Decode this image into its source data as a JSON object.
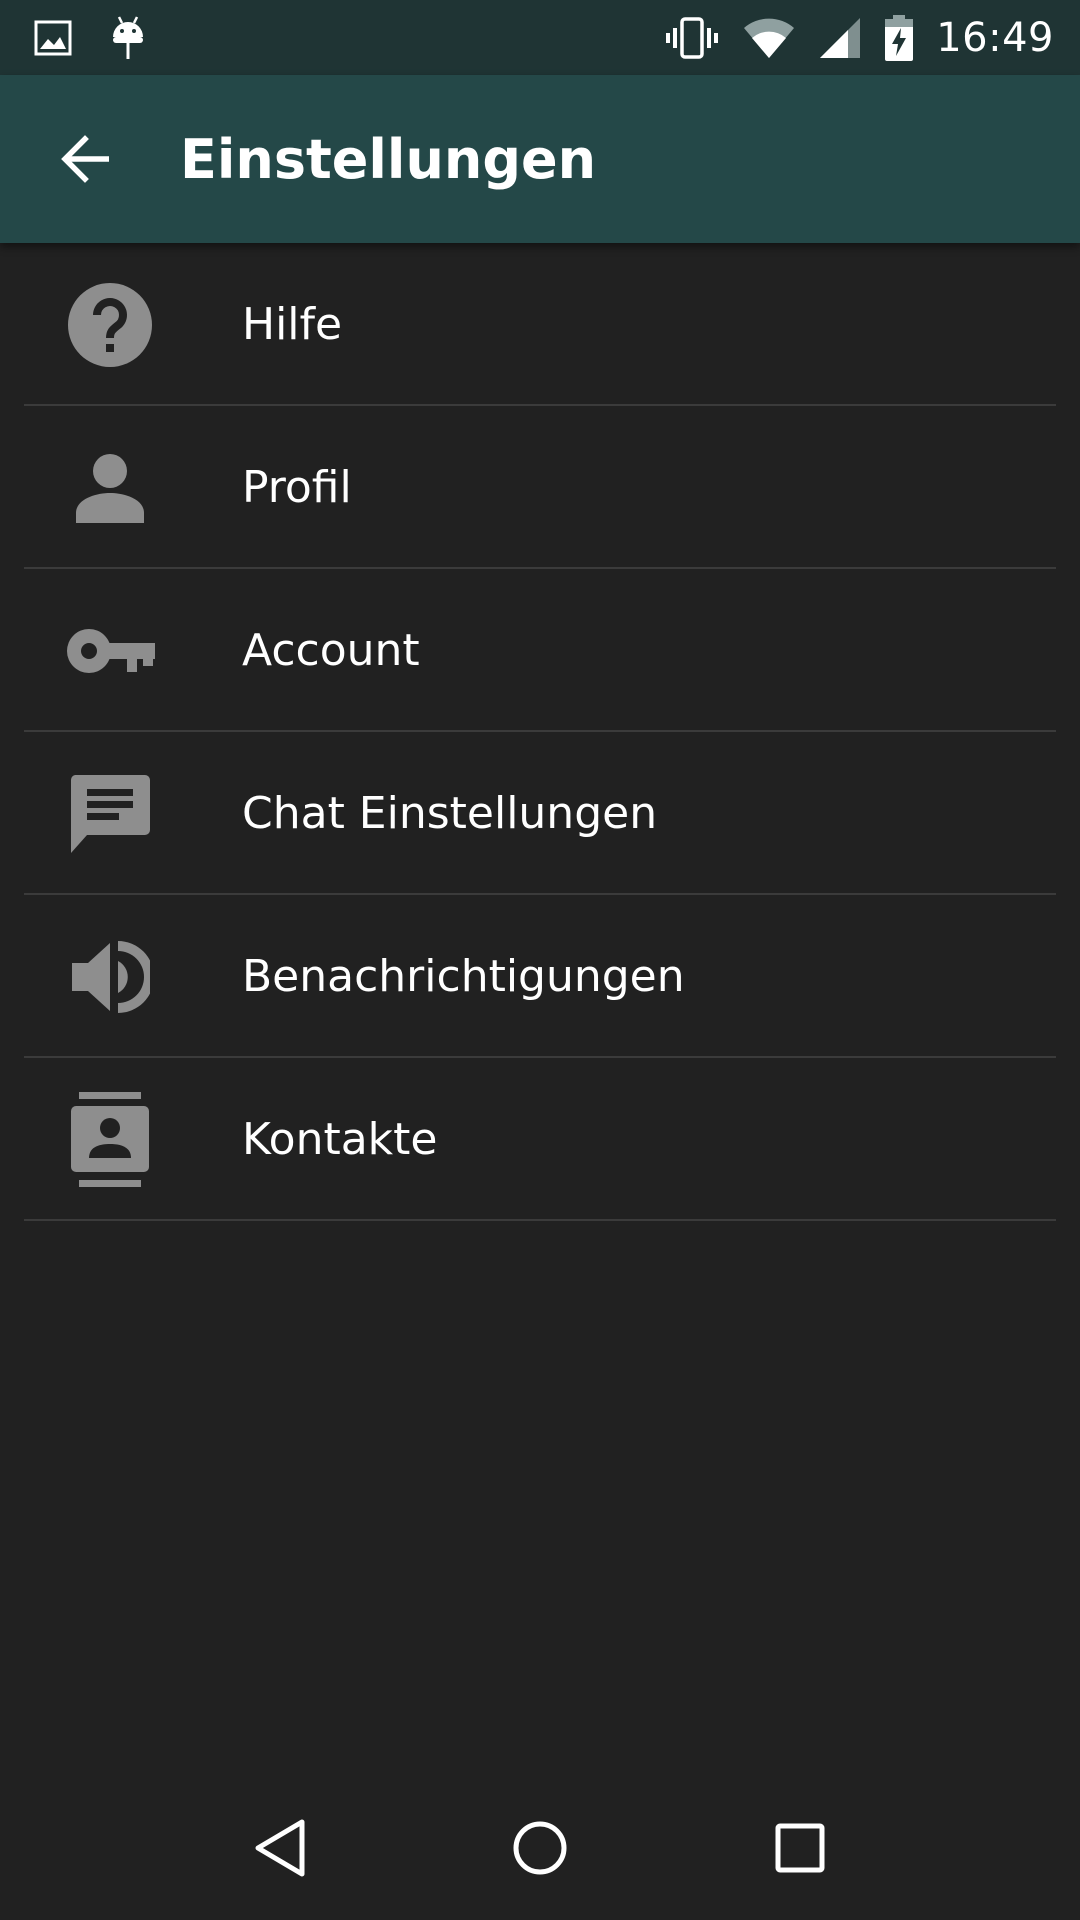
{
  "status_bar": {
    "time": "16:49",
    "icons": [
      "image-icon",
      "android-icon",
      "vibrate-icon",
      "wifi-icon",
      "signal-icon",
      "battery-charging-icon"
    ]
  },
  "app_bar": {
    "title": "Einstellungen",
    "back_icon": "arrow-back-icon"
  },
  "settings": {
    "items": [
      {
        "label": "Hilfe",
        "icon": "help-icon"
      },
      {
        "label": "Profil",
        "icon": "person-icon"
      },
      {
        "label": "Account",
        "icon": "key-icon"
      },
      {
        "label": "Chat Einstellungen",
        "icon": "chat-icon"
      },
      {
        "label": "Benachrichtigungen",
        "icon": "volume-icon"
      },
      {
        "label": "Kontakte",
        "icon": "contacts-icon"
      }
    ]
  },
  "nav_bar": {
    "icons": [
      "nav-back-icon",
      "nav-home-icon",
      "nav-recents-icon"
    ]
  },
  "colors": {
    "status_bar": "#1f3434",
    "app_bar": "#244848",
    "background": "#212121",
    "icon_gray": "#8e8e8e",
    "divider": "#3b3b3b"
  }
}
